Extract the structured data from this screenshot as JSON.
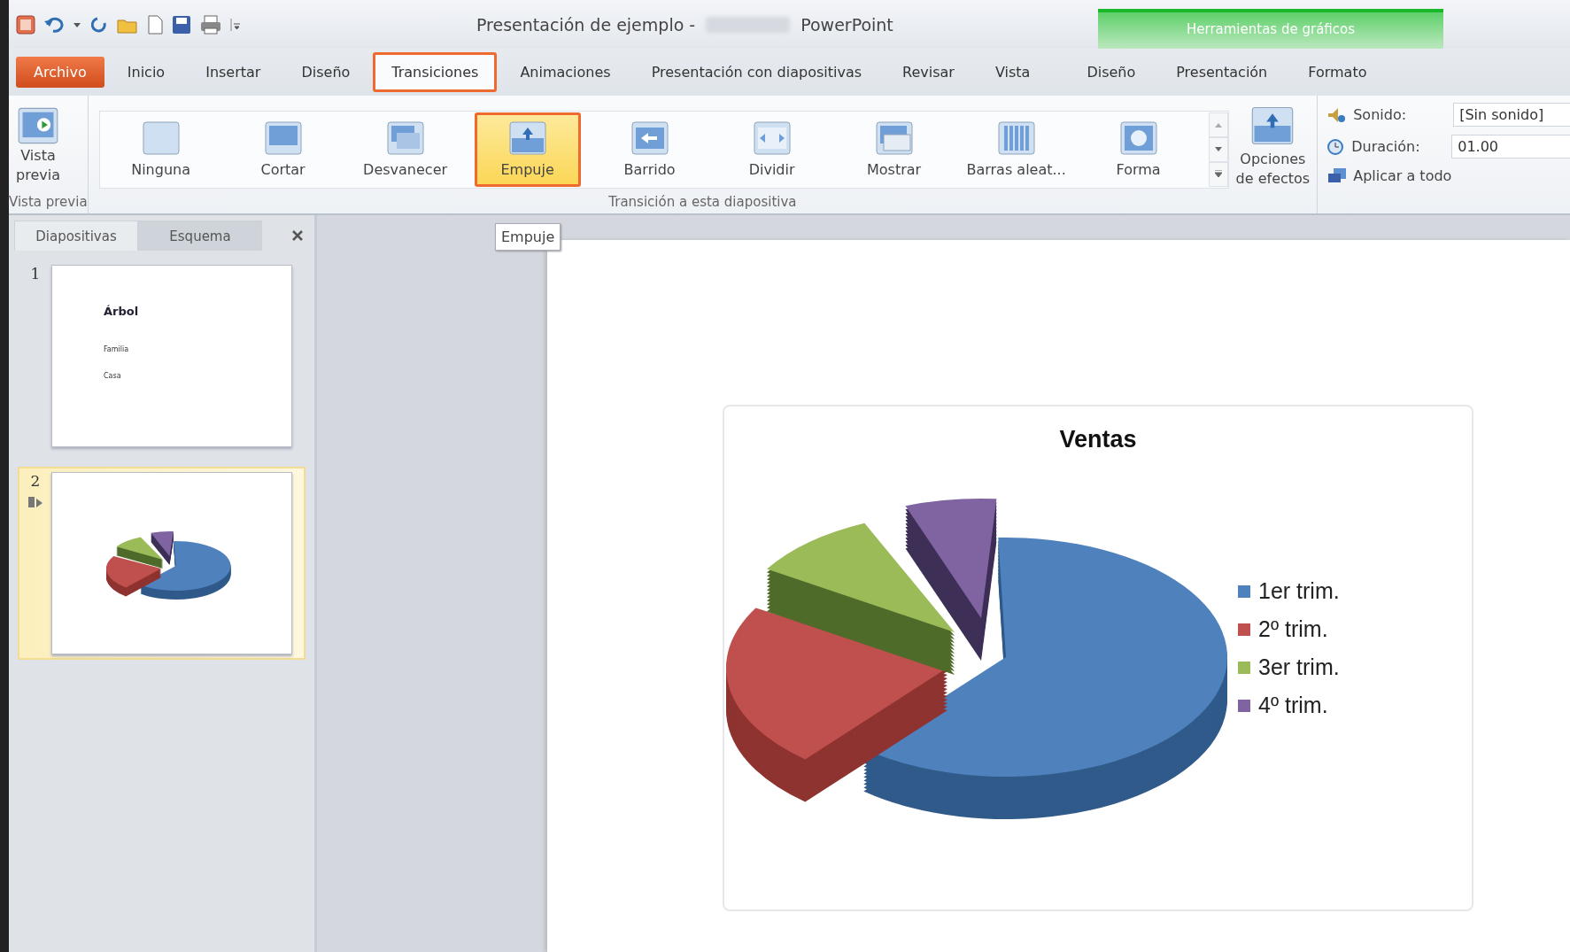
{
  "window": {
    "title": "Presentación de ejemplo -",
    "app_name": "PowerPoint"
  },
  "contextual_group": {
    "label": "Herramientas de gráficos"
  },
  "tabs": [
    {
      "label": "Archivo",
      "kind": "file",
      "selected": false
    },
    {
      "label": "Inicio",
      "kind": "normal",
      "selected": false
    },
    {
      "label": "Insertar",
      "kind": "normal",
      "selected": false
    },
    {
      "label": "Diseño",
      "kind": "normal",
      "selected": false
    },
    {
      "label": "Transiciones",
      "kind": "normal",
      "selected": true
    },
    {
      "label": "Animaciones",
      "kind": "normal",
      "selected": false
    },
    {
      "label": "Presentación con diapositivas",
      "kind": "normal",
      "selected": false
    },
    {
      "label": "Revisar",
      "kind": "normal",
      "selected": false
    },
    {
      "label": "Vista",
      "kind": "normal",
      "selected": false
    },
    {
      "label": "Diseño",
      "kind": "contextual",
      "selected": false
    },
    {
      "label": "Presentación",
      "kind": "contextual",
      "selected": false
    },
    {
      "label": "Formato",
      "kind": "contextual",
      "selected": false
    }
  ],
  "ribbon": {
    "preview": {
      "button_lines": [
        "Vista",
        "previa"
      ],
      "group_label": "Vista previa"
    },
    "gallery": {
      "group_label": "Transición a esta diapositiva",
      "items": [
        {
          "label": "Ninguna",
          "selected": false
        },
        {
          "label": "Cortar",
          "selected": false
        },
        {
          "label": "Desvanecer",
          "selected": false
        },
        {
          "label": "Empuje",
          "selected": true
        },
        {
          "label": "Barrido",
          "selected": false
        },
        {
          "label": "Dividir",
          "selected": false
        },
        {
          "label": "Mostrar",
          "selected": false
        },
        {
          "label": "Barras aleat...",
          "selected": false
        },
        {
          "label": "Forma",
          "selected": false
        }
      ]
    },
    "effect_options": {
      "lines": [
        "Opciones",
        "de efectos"
      ]
    },
    "timing": {
      "sound_label": "Sonido:",
      "sound_value": "[Sin sonido]",
      "duration_label": "Duración:",
      "duration_value": "01.00",
      "apply_all": "Aplicar a todo"
    }
  },
  "tooltip": "Empuje",
  "pane": {
    "tabs": [
      {
        "label": "Diapositivas",
        "selected": true
      },
      {
        "label": "Esquema",
        "selected": false
      }
    ],
    "slides": [
      {
        "number": "1",
        "kind": "text",
        "selected": false,
        "title": "Árbol",
        "lines": [
          "Familia",
          "Casa"
        ]
      },
      {
        "number": "2",
        "kind": "chart",
        "selected": true
      }
    ]
  },
  "slide": {
    "chart": {
      "title": "Ventas",
      "legend": [
        {
          "label": "1er trim.",
          "color": "#4f81bd"
        },
        {
          "label": "2º trim.",
          "color": "#c0504d"
        },
        {
          "label": "3er trim.",
          "color": "#9bbb59"
        },
        {
          "label": "4º trim.",
          "color": "#8064a2"
        }
      ]
    }
  }
}
